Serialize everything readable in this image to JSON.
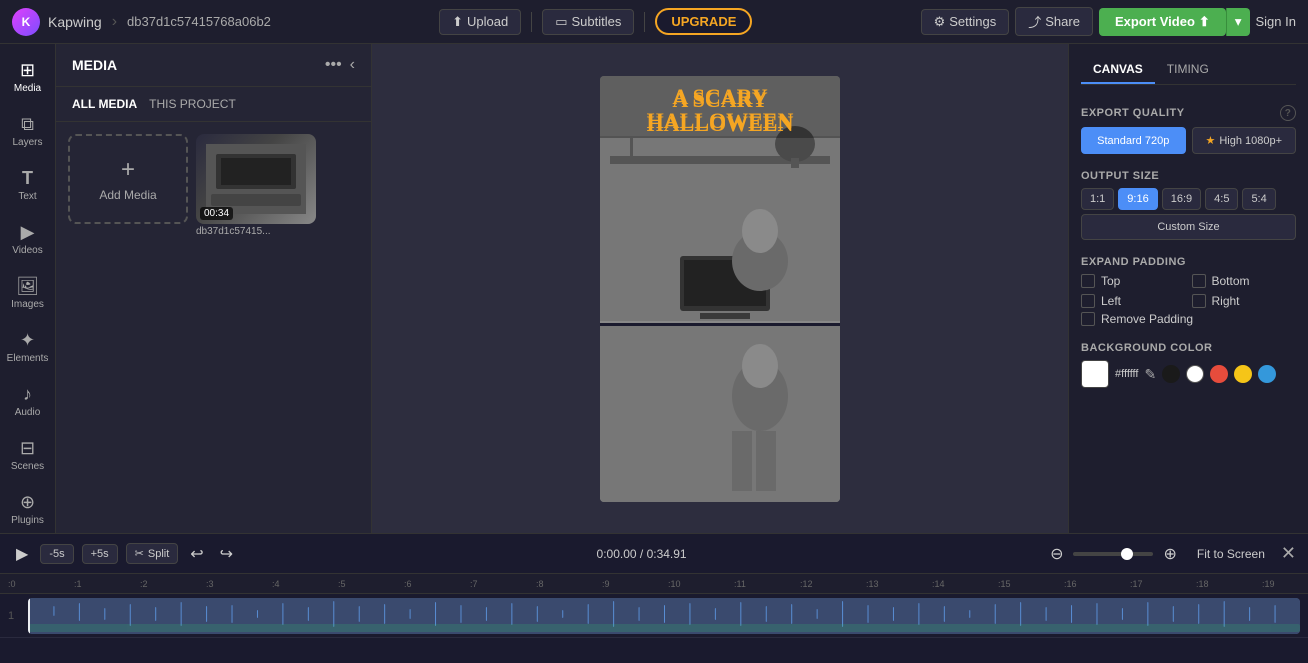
{
  "app": {
    "logo_text": "K",
    "brand": "Kapwing",
    "separator": "›",
    "project_id": "db37d1c57415768a06b2"
  },
  "topbar": {
    "upload_label": "Upload",
    "subtitles_label": "Subtitles",
    "upgrade_label": "UPGRADE",
    "settings_label": "Settings",
    "share_label": "Share",
    "export_label": "Export Video",
    "signin_label": "Sign In"
  },
  "sidebar": {
    "items": [
      {
        "id": "media",
        "label": "Media",
        "icon": "⊞",
        "active": true
      },
      {
        "id": "layers",
        "label": "Layers",
        "icon": "⧉"
      },
      {
        "id": "text",
        "label": "Text",
        "icon": "T"
      },
      {
        "id": "videos",
        "label": "Videos",
        "icon": "▶"
      },
      {
        "id": "images",
        "label": "Images",
        "icon": "🖼"
      },
      {
        "id": "elements",
        "label": "Elements",
        "icon": "✦"
      },
      {
        "id": "audio",
        "label": "Audio",
        "icon": "♪"
      },
      {
        "id": "scenes",
        "label": "Scenes",
        "icon": "⊟"
      },
      {
        "id": "plugins",
        "label": "Plugins",
        "icon": "⊕"
      }
    ]
  },
  "left_panel": {
    "title": "MEDIA",
    "tabs": [
      {
        "label": "ALL MEDIA",
        "active": true
      },
      {
        "label": "THIS PROJECT",
        "active": false
      }
    ],
    "more_icon": "•••",
    "add_media_label": "Add Media",
    "media_items": [
      {
        "duration": "00:34",
        "name": "db37d1c57415...",
        "has_video": true
      }
    ]
  },
  "canvas": {
    "title_line1": "A SCARY",
    "title_line2": "HALLOWEEN"
  },
  "right_panel": {
    "tabs": [
      {
        "label": "CANVAS",
        "active": true
      },
      {
        "label": "TIMING",
        "active": false
      }
    ],
    "export_quality": {
      "label": "EXPORT QUALITY",
      "standard_label": "Standard 720p",
      "high_label": "High 1080p+",
      "star": "★"
    },
    "output_size": {
      "label": "OUTPUT SIZE",
      "options": [
        "1:1",
        "9:16",
        "16:9",
        "4:5",
        "5:4"
      ],
      "active": "9:16",
      "custom_size_label": "Custom Size"
    },
    "expand_padding": {
      "label": "EXPAND PADDING",
      "options": [
        {
          "label": "Top",
          "checked": false
        },
        {
          "label": "Bottom",
          "checked": false
        },
        {
          "label": "Left",
          "checked": false
        },
        {
          "label": "Right",
          "checked": false
        }
      ],
      "remove_padding_label": "Remove Padding"
    },
    "background_color": {
      "label": "BACKGROUND COLOR",
      "hex_value": "#ffffff",
      "edit_icon": "✎",
      "presets": [
        {
          "color": "#1a1a1a"
        },
        {
          "color": "#ffffff"
        },
        {
          "color": "#e74c3c"
        },
        {
          "color": "#f39c12"
        },
        {
          "color": "#3498db"
        }
      ]
    }
  },
  "timeline": {
    "play_icon": "▶",
    "skip_back_label": "-5s",
    "skip_fwd_label": "+5s",
    "split_label": "Split",
    "undo_icon": "↩",
    "redo_icon": "↪",
    "current_time": "0:00.00",
    "total_time": "0:34.91",
    "time_display": "0:00.00 / 0:34.91",
    "zoom_in_icon": "−",
    "zoom_out_icon": "+",
    "fit_screen_label": "Fit to Screen",
    "close_icon": "✕",
    "ruler_marks": [
      ":0",
      ":1",
      ":2",
      ":3",
      ":4",
      ":5",
      ":6",
      ":7",
      ":8",
      ":9",
      ":10",
      ":11",
      ":12",
      ":13",
      ":14",
      ":15",
      ":16",
      ":17",
      ":18",
      ":19"
    ],
    "track_number": "1"
  }
}
